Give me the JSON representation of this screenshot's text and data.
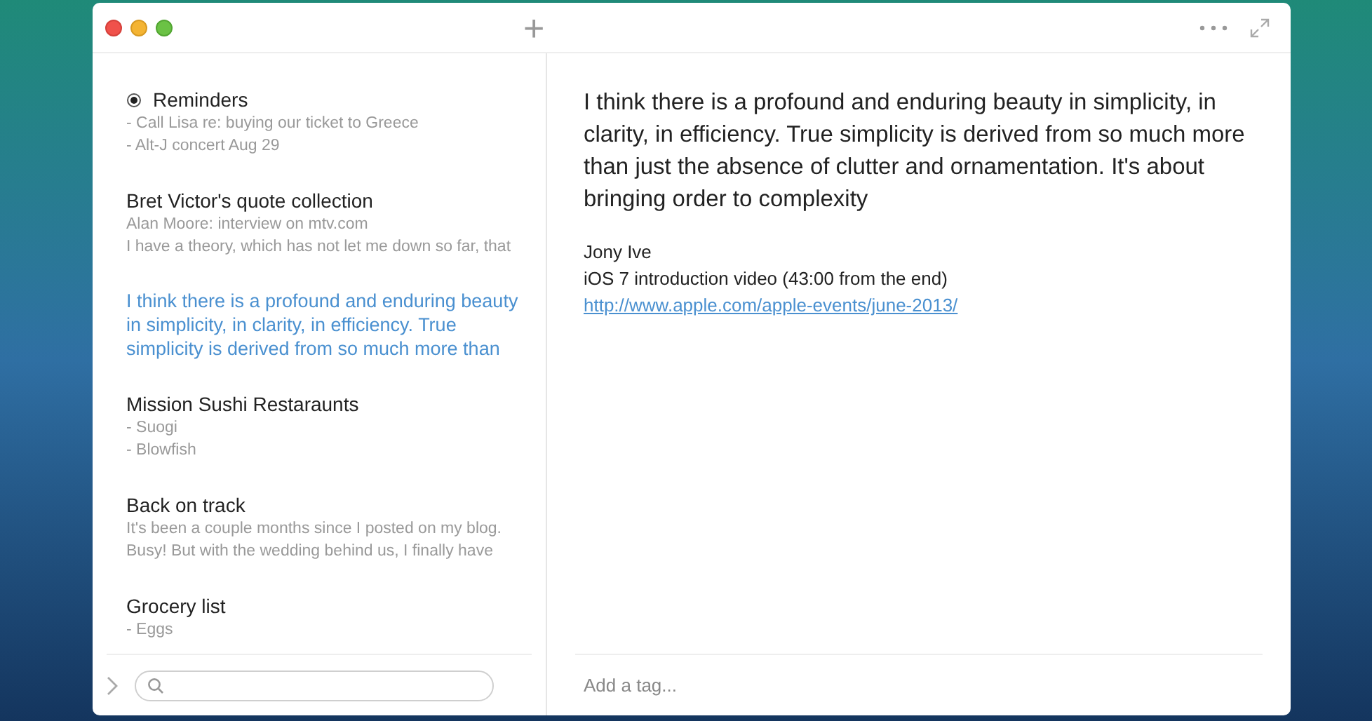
{
  "toolbar": {
    "new_note": "+"
  },
  "notes": [
    {
      "title": "Reminders",
      "pinned": true,
      "selected": false,
      "lines": [
        "- Call Lisa re: buying our ticket to Greece",
        "- Alt-J concert Aug 29"
      ]
    },
    {
      "title": "Bret Victor's quote collection",
      "pinned": false,
      "selected": false,
      "lines": [
        "Alan Moore: interview on mtv.com",
        "I have a theory, which has not let me down so far, that"
      ]
    },
    {
      "pinned": false,
      "selected": true,
      "lines": [
        "I think there is a profound and enduring beauty",
        "in simplicity, in clarity, in efficiency. True",
        "simplicity is derived from so much more than"
      ]
    },
    {
      "title": "Mission Sushi Restaraunts",
      "pinned": false,
      "selected": false,
      "lines": [
        "- Suogi",
        "- Blowfish"
      ]
    },
    {
      "title": "Back on track",
      "pinned": false,
      "selected": false,
      "lines": [
        "It's been a couple months since I posted on my blog.",
        "Busy! But with the wedding behind us, I finally have"
      ]
    },
    {
      "title": "Grocery list",
      "pinned": false,
      "selected": false,
      "lines": [
        "- Eggs"
      ]
    }
  ],
  "editor": {
    "body": "I think there is a profound and enduring beauty in simplicity, in clarity, in efficiency. True simplicity is derived from so much more than just the absence of clutter and ornamentation. It's about bringing order to complexity",
    "lines": [
      "Jony Ive",
      "iOS 7 introduction video (43:00 from the end)"
    ],
    "link": "http://www.apple.com/apple-events/june-2013/"
  },
  "tag_field": {
    "placeholder": "Add a tag..."
  }
}
